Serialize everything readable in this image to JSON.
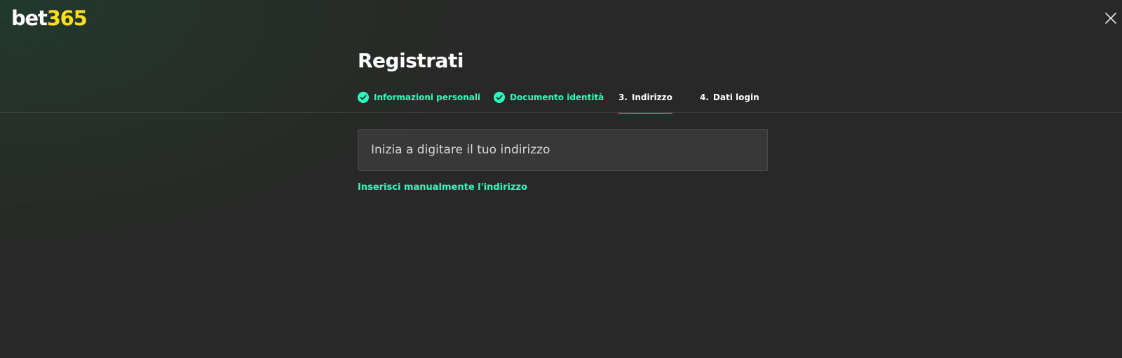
{
  "brand": {
    "logo_part1": "bet",
    "logo_part2": "365"
  },
  "page": {
    "title": "Registrati"
  },
  "steps": [
    {
      "label": "Informazioni personali",
      "status": "done",
      "icon": "check-circle-icon"
    },
    {
      "label": "Documento identità",
      "status": "done",
      "icon": "check-circle-icon"
    },
    {
      "number": "3.",
      "label": "Indirizzo",
      "status": "current"
    },
    {
      "number": "4.",
      "label": "Dati login",
      "status": "todo"
    }
  ],
  "address": {
    "placeholder": "Inizia a digitare il tuo indirizzo",
    "value": ""
  },
  "manual_entry": {
    "label": "Inserisci manualmente l'indirizzo"
  },
  "icons": {
    "close": "close-icon"
  },
  "colors": {
    "accent": "#26ffbe",
    "brand_yellow": "#ffdf1b",
    "background": "#282828",
    "input_background": "#383838"
  }
}
